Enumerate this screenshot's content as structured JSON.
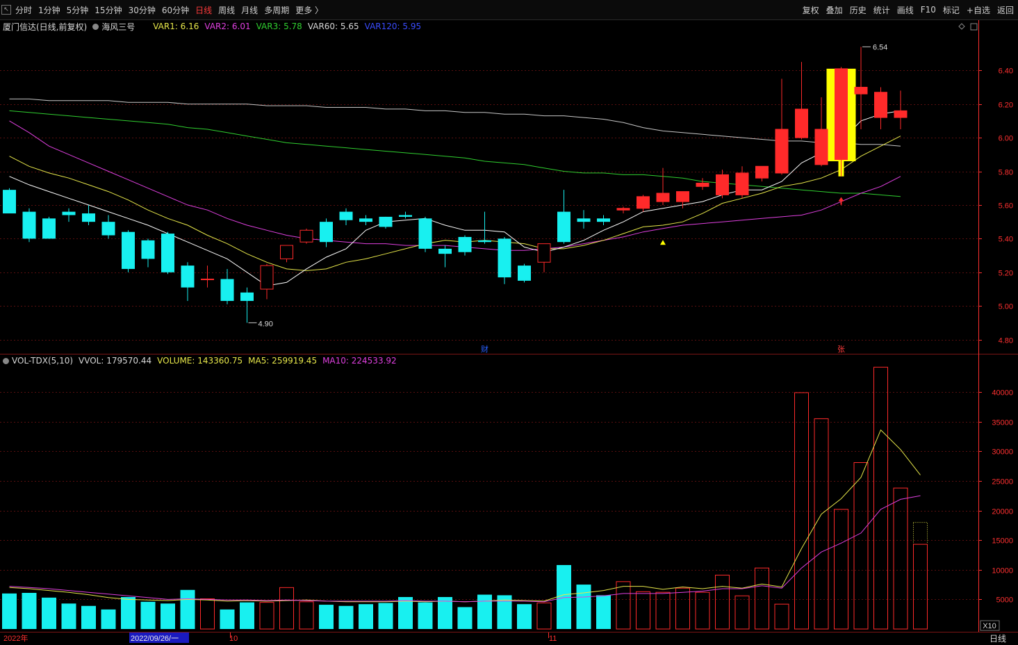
{
  "toolbar": {
    "periods": [
      "分时",
      "1分钟",
      "5分钟",
      "15分钟",
      "30分钟",
      "60分钟",
      "日线",
      "周线",
      "月线",
      "多周期",
      "更多 〉"
    ],
    "active_index": 6,
    "tools": [
      "复权",
      "叠加",
      "历史",
      "统计",
      "画线",
      "F10",
      "标记",
      "+自选",
      "返回"
    ]
  },
  "info": {
    "title": "厦门信达(日线,前复权)",
    "indicator": "海风三号",
    "var1": "VAR1: 6.16",
    "var2": "VAR2: 6.01",
    "var3": "VAR3: 5.78",
    "var60": "VAR60: 5.65",
    "var120": "VAR120: 5.95"
  },
  "vol_info": {
    "name": "VOL-TDX(5,10)",
    "vvol": "VVOL: 179570.44",
    "volume": "VOLUME: 143360.75",
    "ma5": "MA5: 259919.45",
    "ma10": "MA10: 224533.92"
  },
  "colors": {
    "up": "#ff2a2a",
    "down": "#18f0f0",
    "var1": "#ffffff",
    "var2": "#e040e0",
    "var3": "#e8e84a",
    "var60": "#30d030",
    "var120": "#c8c8c8",
    "grid": "#5a0f0f",
    "axis": "#ff3030"
  },
  "chart_data": [
    {
      "type": "candlestick",
      "yticks": [
        4.8,
        5.0,
        5.2,
        5.4,
        5.6,
        5.8,
        6.0,
        6.2,
        6.4
      ],
      "ylim": [
        4.72,
        6.62
      ],
      "annotations": {
        "high_label": "6.54",
        "low_label": "4.90",
        "event_markers": [
          "财",
          "张"
        ]
      },
      "candles": [
        {
          "o": 5.69,
          "h": 5.7,
          "c": 5.55,
          "l": 5.55
        },
        {
          "o": 5.56,
          "h": 5.58,
          "c": 5.4,
          "l": 5.38
        },
        {
          "o": 5.52,
          "h": 5.53,
          "c": 5.4,
          "l": 5.4
        },
        {
          "o": 5.56,
          "h": 5.58,
          "c": 5.54,
          "l": 5.5
        },
        {
          "o": 5.55,
          "h": 5.6,
          "c": 5.5,
          "l": 5.48
        },
        {
          "o": 5.5,
          "h": 5.54,
          "c": 5.42,
          "l": 5.4
        },
        {
          "o": 5.44,
          "h": 5.45,
          "c": 5.22,
          "l": 5.2
        },
        {
          "o": 5.39,
          "h": 5.4,
          "c": 5.28,
          "l": 5.23
        },
        {
          "o": 5.43,
          "h": 5.44,
          "c": 5.2,
          "l": 5.19
        },
        {
          "o": 5.24,
          "h": 5.26,
          "c": 5.11,
          "l": 5.03
        },
        {
          "o": 5.16,
          "h": 5.24,
          "c": 5.16,
          "l": 5.11
        },
        {
          "o": 5.16,
          "h": 5.22,
          "c": 5.03,
          "l": 5.01
        },
        {
          "o": 5.08,
          "h": 5.11,
          "c": 5.03,
          "l": 4.9
        },
        {
          "o": 5.1,
          "h": 5.25,
          "c": 5.24,
          "l": 5.04
        },
        {
          "o": 5.28,
          "h": 5.35,
          "c": 5.36,
          "l": 5.26
        },
        {
          "o": 5.38,
          "h": 5.46,
          "c": 5.45,
          "l": 5.37
        },
        {
          "o": 5.5,
          "h": 5.52,
          "c": 5.38,
          "l": 5.35
        },
        {
          "o": 5.56,
          "h": 5.58,
          "c": 5.51,
          "l": 5.48
        },
        {
          "o": 5.52,
          "h": 5.54,
          "c": 5.5,
          "l": 5.48
        },
        {
          "o": 5.53,
          "h": 5.53,
          "c": 5.47,
          "l": 5.46
        },
        {
          "o": 5.54,
          "h": 5.56,
          "c": 5.53,
          "l": 5.52
        },
        {
          "o": 5.52,
          "h": 5.53,
          "c": 5.34,
          "l": 5.32
        },
        {
          "o": 5.34,
          "h": 5.36,
          "c": 5.31,
          "l": 5.23
        },
        {
          "o": 5.41,
          "h": 5.42,
          "c": 5.32,
          "l": 5.3
        },
        {
          "o": 5.39,
          "h": 5.56,
          "c": 5.38,
          "l": 5.37
        },
        {
          "o": 5.4,
          "h": 5.41,
          "c": 5.17,
          "l": 5.13
        },
        {
          "o": 5.24,
          "h": 5.25,
          "c": 5.15,
          "l": 5.14
        },
        {
          "o": 5.26,
          "h": 5.3,
          "c": 5.37,
          "l": 5.2
        },
        {
          "o": 5.56,
          "h": 5.69,
          "c": 5.38,
          "l": 5.37
        },
        {
          "o": 5.52,
          "h": 5.57,
          "c": 5.5,
          "l": 5.46
        },
        {
          "o": 5.52,
          "h": 5.54,
          "c": 5.5,
          "l": 5.48
        },
        {
          "o": 5.57,
          "h": 5.59,
          "c": 5.58,
          "l": 5.55
        },
        {
          "o": 5.58,
          "h": 5.66,
          "c": 5.65,
          "l": 5.56
        },
        {
          "o": 5.62,
          "h": 5.82,
          "c": 5.67,
          "l": 5.6
        },
        {
          "o": 5.62,
          "h": 5.68,
          "c": 5.68,
          "l": 5.58
        },
        {
          "o": 5.71,
          "h": 5.76,
          "c": 5.73,
          "l": 5.69
        },
        {
          "o": 5.66,
          "h": 5.81,
          "c": 5.78,
          "l": 5.64
        },
        {
          "o": 5.66,
          "h": 5.83,
          "c": 5.79,
          "l": 5.64
        },
        {
          "o": 5.76,
          "h": 5.83,
          "c": 5.83,
          "l": 5.74
        },
        {
          "o": 5.79,
          "h": 6.35,
          "c": 6.05,
          "l": 5.78
        },
        {
          "o": 6.0,
          "h": 6.45,
          "c": 6.17,
          "l": 5.99
        },
        {
          "o": 5.84,
          "h": 6.24,
          "c": 6.05,
          "l": 5.83
        },
        {
          "o": 5.87,
          "h": 6.42,
          "c": 6.41,
          "l": 5.77
        },
        {
          "o": 6.26,
          "h": 6.54,
          "c": 6.3,
          "l": 6.05
        },
        {
          "o": 6.12,
          "h": 6.3,
          "c": 6.27,
          "l": 6.05
        },
        {
          "o": 6.12,
          "h": 6.28,
          "c": 6.16,
          "l": 6.05
        }
      ],
      "lines": {
        "var1": [
          5.77,
          5.72,
          5.68,
          5.64,
          5.6,
          5.56,
          5.52,
          5.48,
          5.43,
          5.38,
          5.33,
          5.28,
          5.2,
          5.12,
          5.14,
          5.22,
          5.29,
          5.34,
          5.45,
          5.5,
          5.51,
          5.52,
          5.48,
          5.45,
          5.45,
          5.44,
          5.35,
          5.32,
          5.35,
          5.39,
          5.45,
          5.5,
          5.56,
          5.58,
          5.6,
          5.62,
          5.66,
          5.69,
          5.69,
          5.74,
          5.85,
          5.91,
          5.98,
          6.1,
          6.14,
          6.16
        ],
        "var2": [
          6.1,
          6.03,
          5.95,
          5.9,
          5.85,
          5.8,
          5.75,
          5.7,
          5.65,
          5.6,
          5.57,
          5.52,
          5.48,
          5.45,
          5.42,
          5.4,
          5.39,
          5.38,
          5.37,
          5.37,
          5.36,
          5.36,
          5.36,
          5.35,
          5.34,
          5.33,
          5.33,
          5.34,
          5.35,
          5.37,
          5.39,
          5.41,
          5.44,
          5.46,
          5.48,
          5.49,
          5.5,
          5.51,
          5.52,
          5.53,
          5.54,
          5.57,
          5.62,
          5.67,
          5.71,
          5.77
        ],
        "var3": [
          5.89,
          5.83,
          5.79,
          5.76,
          5.72,
          5.68,
          5.63,
          5.57,
          5.52,
          5.48,
          5.42,
          5.37,
          5.31,
          5.26,
          5.22,
          5.21,
          5.22,
          5.26,
          5.28,
          5.31,
          5.34,
          5.37,
          5.39,
          5.38,
          5.39,
          5.38,
          5.37,
          5.34,
          5.34,
          5.36,
          5.39,
          5.43,
          5.47,
          5.48,
          5.5,
          5.55,
          5.61,
          5.64,
          5.67,
          5.71,
          5.73,
          5.76,
          5.81,
          5.89,
          5.95,
          6.01
        ],
        "var60": [
          6.16,
          6.15,
          6.14,
          6.13,
          6.12,
          6.11,
          6.1,
          6.09,
          6.08,
          6.06,
          6.05,
          6.03,
          6.01,
          5.99,
          5.97,
          5.96,
          5.95,
          5.94,
          5.93,
          5.92,
          5.91,
          5.9,
          5.89,
          5.88,
          5.86,
          5.85,
          5.84,
          5.82,
          5.8,
          5.79,
          5.79,
          5.78,
          5.78,
          5.77,
          5.76,
          5.74,
          5.73,
          5.72,
          5.71,
          5.7,
          5.69,
          5.68,
          5.67,
          5.67,
          5.66,
          5.65
        ],
        "var120": [
          6.23,
          6.23,
          6.22,
          6.22,
          6.22,
          6.22,
          6.21,
          6.21,
          6.21,
          6.2,
          6.2,
          6.2,
          6.2,
          6.19,
          6.19,
          6.19,
          6.18,
          6.18,
          6.18,
          6.17,
          6.17,
          6.16,
          6.16,
          6.15,
          6.15,
          6.14,
          6.14,
          6.13,
          6.13,
          6.12,
          6.11,
          6.09,
          6.06,
          6.04,
          6.03,
          6.02,
          6.01,
          6.0,
          5.99,
          5.98,
          5.98,
          5.97,
          5.97,
          5.96,
          5.96,
          5.95
        ]
      }
    },
    {
      "type": "bar",
      "name": "volume",
      "yticks": [
        5000,
        10000,
        15000,
        20000,
        25000,
        30000,
        35000,
        40000
      ],
      "ylim": [
        0,
        44000
      ],
      "unit_badge": "X10",
      "values": [
        6000,
        6100,
        5300,
        4300,
        3900,
        3300,
        5400,
        4600,
        4300,
        6600,
        5100,
        3300,
        4500,
        4500,
        7000,
        4600,
        4100,
        3900,
        4200,
        4400,
        5400,
        4500,
        5400,
        3700,
        5800,
        5700,
        4200,
        4400,
        10800,
        7500,
        5700,
        8000,
        6300,
        6200,
        6900,
        6200,
        9100,
        5600,
        10300,
        4200,
        39900,
        35500,
        20200,
        28100,
        44200,
        23800,
        14300
      ],
      "ma5": [
        7000,
        6800,
        6500,
        6200,
        5800,
        5300,
        5000,
        4900,
        4800,
        5000,
        4900,
        4700,
        4800,
        4700,
        4800,
        4900,
        4700,
        4600,
        4600,
        4600,
        4700,
        4600,
        4700,
        4600,
        4700,
        4900,
        4800,
        4700,
        5800,
        6100,
        6500,
        7200,
        7200,
        6700,
        7100,
        6800,
        7200,
        6900,
        7600,
        7100,
        13600,
        19400,
        22000,
        25600,
        33600,
        30300,
        26000
      ],
      "ma10": [
        7200,
        7000,
        6800,
        6500,
        6200,
        5900,
        5600,
        5300,
        5000,
        5100,
        5000,
        4900,
        4900,
        4800,
        4900,
        4800,
        4700,
        4700,
        4700,
        4700,
        4800,
        4700,
        4700,
        4600,
        4700,
        4700,
        4700,
        4600,
        5300,
        5400,
        5600,
        6000,
        6000,
        6000,
        6200,
        6400,
        6800,
        6800,
        7300,
        6900,
        10300,
        13000,
        14500,
        16200,
        20200,
        21900,
        22500
      ],
      "x_labels": [
        "2022年",
        "2022/09/26/一",
        "10",
        "11"
      ],
      "period_label": "日线"
    }
  ]
}
